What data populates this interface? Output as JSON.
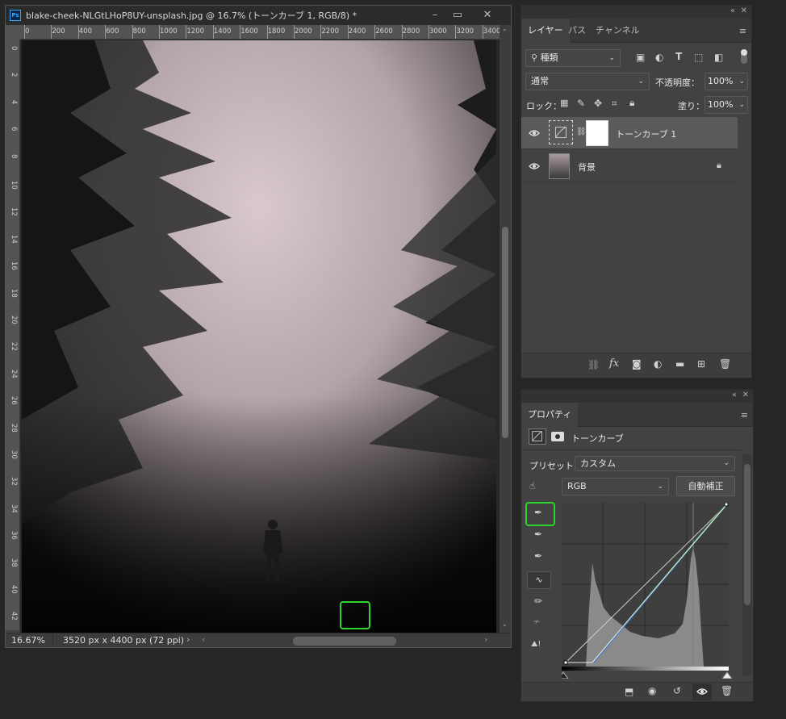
{
  "document": {
    "title": "blake-cheek-NLGtLHoP8UY-unsplash.jpg @ 16.7% (トーンカーブ 1, RGB/8) *",
    "app_badge": "Ps",
    "zoom": "16.67%",
    "doc_info": "3520 px x 4400 px (72 ppi)",
    "ruler_h": [
      "0",
      "200",
      "400",
      "600",
      "800",
      "1000",
      "1200",
      "1400",
      "1600",
      "1800",
      "2000",
      "2200",
      "2400",
      "2600",
      "2800",
      "3000",
      "3200",
      "3400"
    ],
    "ruler_v": [
      "0",
      "2",
      "4",
      "6",
      "8",
      "10",
      "12",
      "14",
      "16",
      "18",
      "20",
      "22",
      "24",
      "26",
      "28",
      "30",
      "32",
      "34",
      "36",
      "38",
      "40",
      "42"
    ]
  },
  "layers_panel": {
    "tabs": [
      "レイヤー",
      "パス",
      "チャンネル"
    ],
    "filter_label": "種類",
    "blend_mode": "通常",
    "opacity_label": "不透明度：",
    "opacity_value": "100%",
    "lock_label": "ロック：",
    "fill_label": "塗り：",
    "fill_value": "100%",
    "layers": [
      {
        "name": "トーンカーブ 1",
        "selected": true,
        "type": "adjustment"
      },
      {
        "name": "背景",
        "selected": false,
        "type": "background",
        "locked": true
      }
    ]
  },
  "properties_panel": {
    "tab": "プロパティ",
    "title": "トーンカーブ",
    "preset_label": "プリセット：",
    "preset_value": "カスタム",
    "channel_value": "RGB",
    "auto_button": "自動補正"
  },
  "colors": {
    "highlight": "#2bd52b",
    "panel_bg": "#424242",
    "app_bg": "#262626"
  }
}
